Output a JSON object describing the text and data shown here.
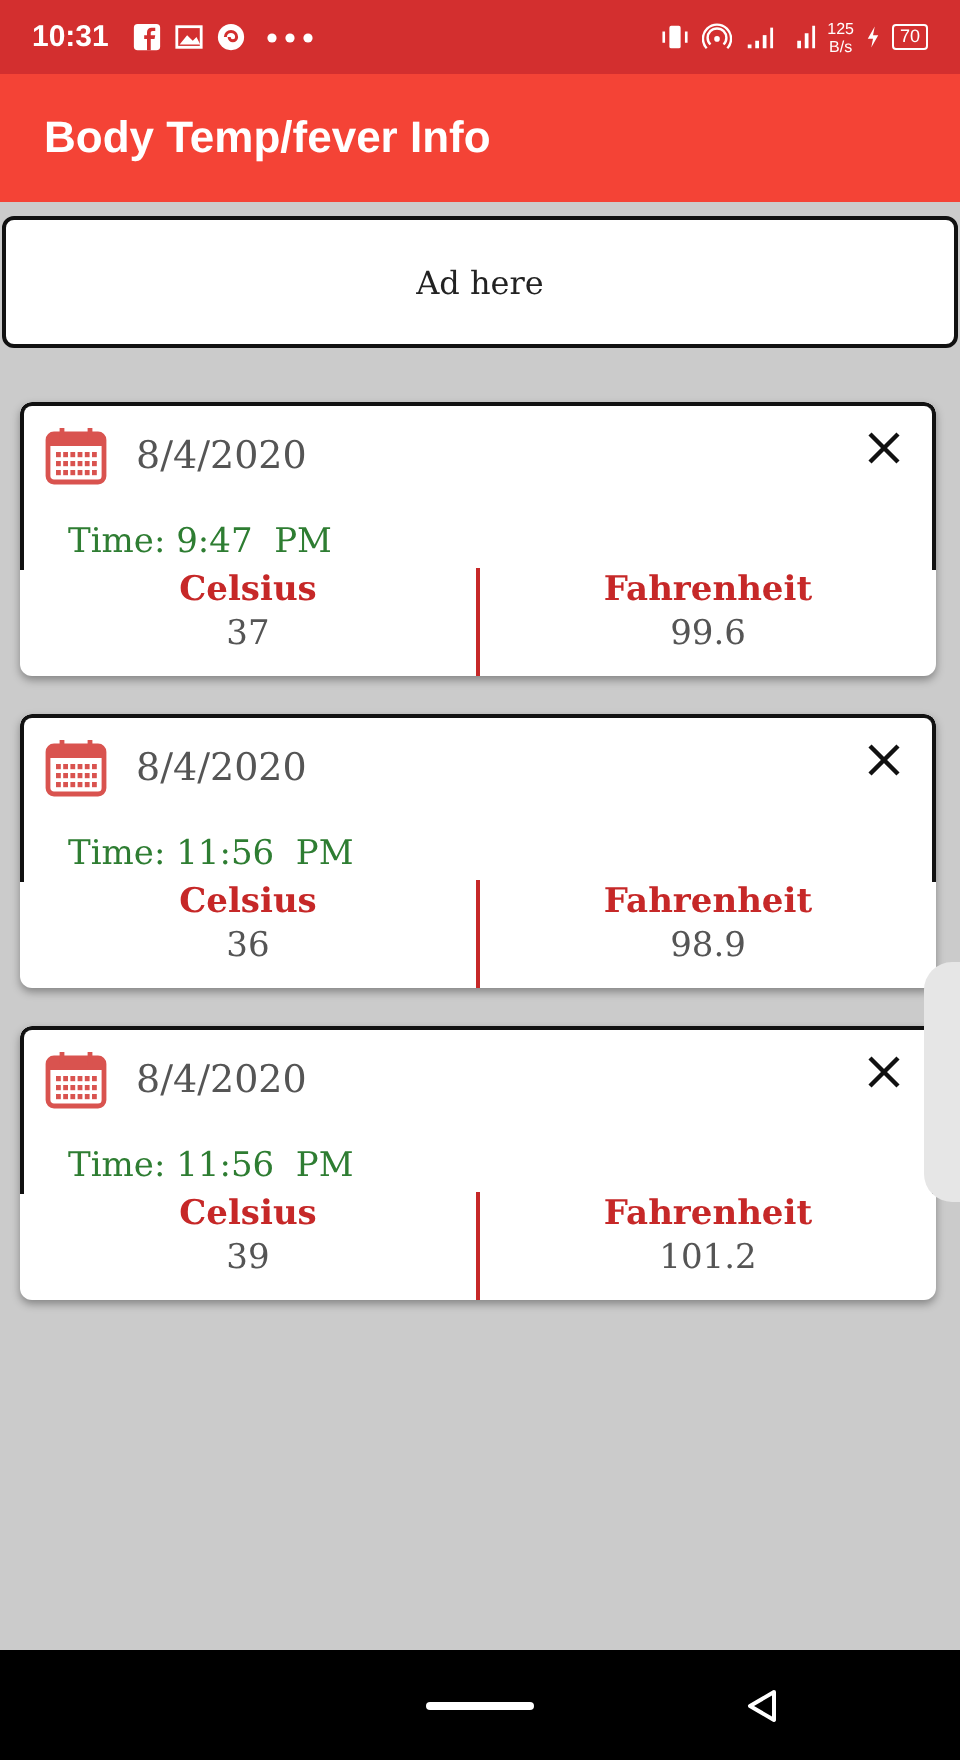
{
  "status_bar": {
    "time": "10:31",
    "speed_value": "125",
    "speed_unit": "B/s",
    "battery": "70"
  },
  "app_bar": {
    "title": "Body Temp/fever Info"
  },
  "ad": {
    "label": "Ad here"
  },
  "records": [
    {
      "date": "8/4/2020",
      "time": "Time: 9:47  PM",
      "celsius_label": "Celsius",
      "celsius": "37",
      "fahrenheit_label": "Fahrenheit",
      "fahrenheit": "99.6"
    },
    {
      "date": "8/4/2020",
      "time": "Time: 11:56  PM",
      "celsius_label": "Celsius",
      "celsius": "36",
      "fahrenheit_label": "Fahrenheit",
      "fahrenheit": "98.9"
    },
    {
      "date": "8/4/2020",
      "time": "Time: 11:56  PM",
      "celsius_label": "Celsius",
      "celsius": "39",
      "fahrenheit_label": "Fahrenheit",
      "fahrenheit": "101.2"
    }
  ]
}
